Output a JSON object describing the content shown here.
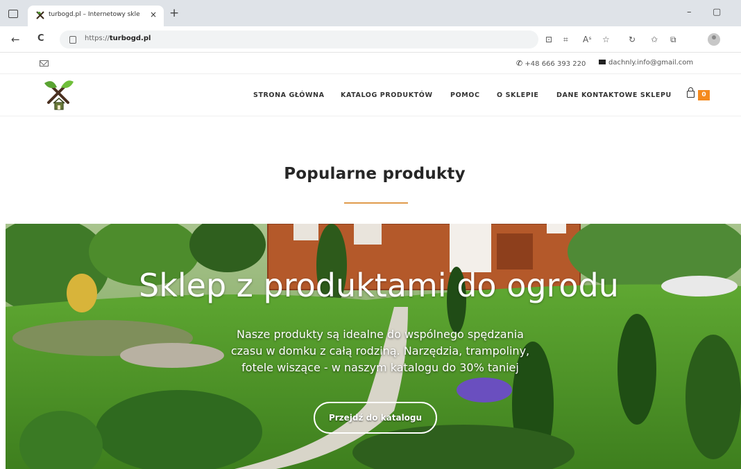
{
  "browser": {
    "tab_title": "turbogd.pl – Internetowy sklep o...",
    "tab_close": "×",
    "new_tab": "+",
    "url_prefix": "https://",
    "url_domain": "turbogd.pl",
    "back": "←",
    "reload": "C",
    "window_controls": {
      "minimize": "–",
      "maximize": "▢",
      "close": "✕"
    }
  },
  "topbar": {
    "phone": "+48 666 393 220",
    "email": "dachnly.info@gmail.com"
  },
  "nav": {
    "items": [
      {
        "label": "STRONA GŁÓWNA"
      },
      {
        "label": "KATALOG PRODUKTÓW"
      },
      {
        "label": "POMOC"
      },
      {
        "label": "O SKLEPIE"
      },
      {
        "label": "DANE KONTAKTOWE SKLEPU"
      }
    ],
    "cart_count": "0"
  },
  "section": {
    "title": "Popularne produkty",
    "accent_color": "#e09a4b"
  },
  "hero": {
    "title": "Sklep z produktami do ogrodu",
    "lines": [
      "Nasze produkty są idealne do wspólnego spędzania",
      "czasu w domku z całą rodziną. Narzędzia, trampoliny,",
      "fotele wiszące - w naszym katalogu do 30% taniej"
    ],
    "button": "Przejdź do katalogu"
  },
  "colors": {
    "cart_badge": "#f48a1e",
    "tabbar": "#dfe3e8"
  }
}
